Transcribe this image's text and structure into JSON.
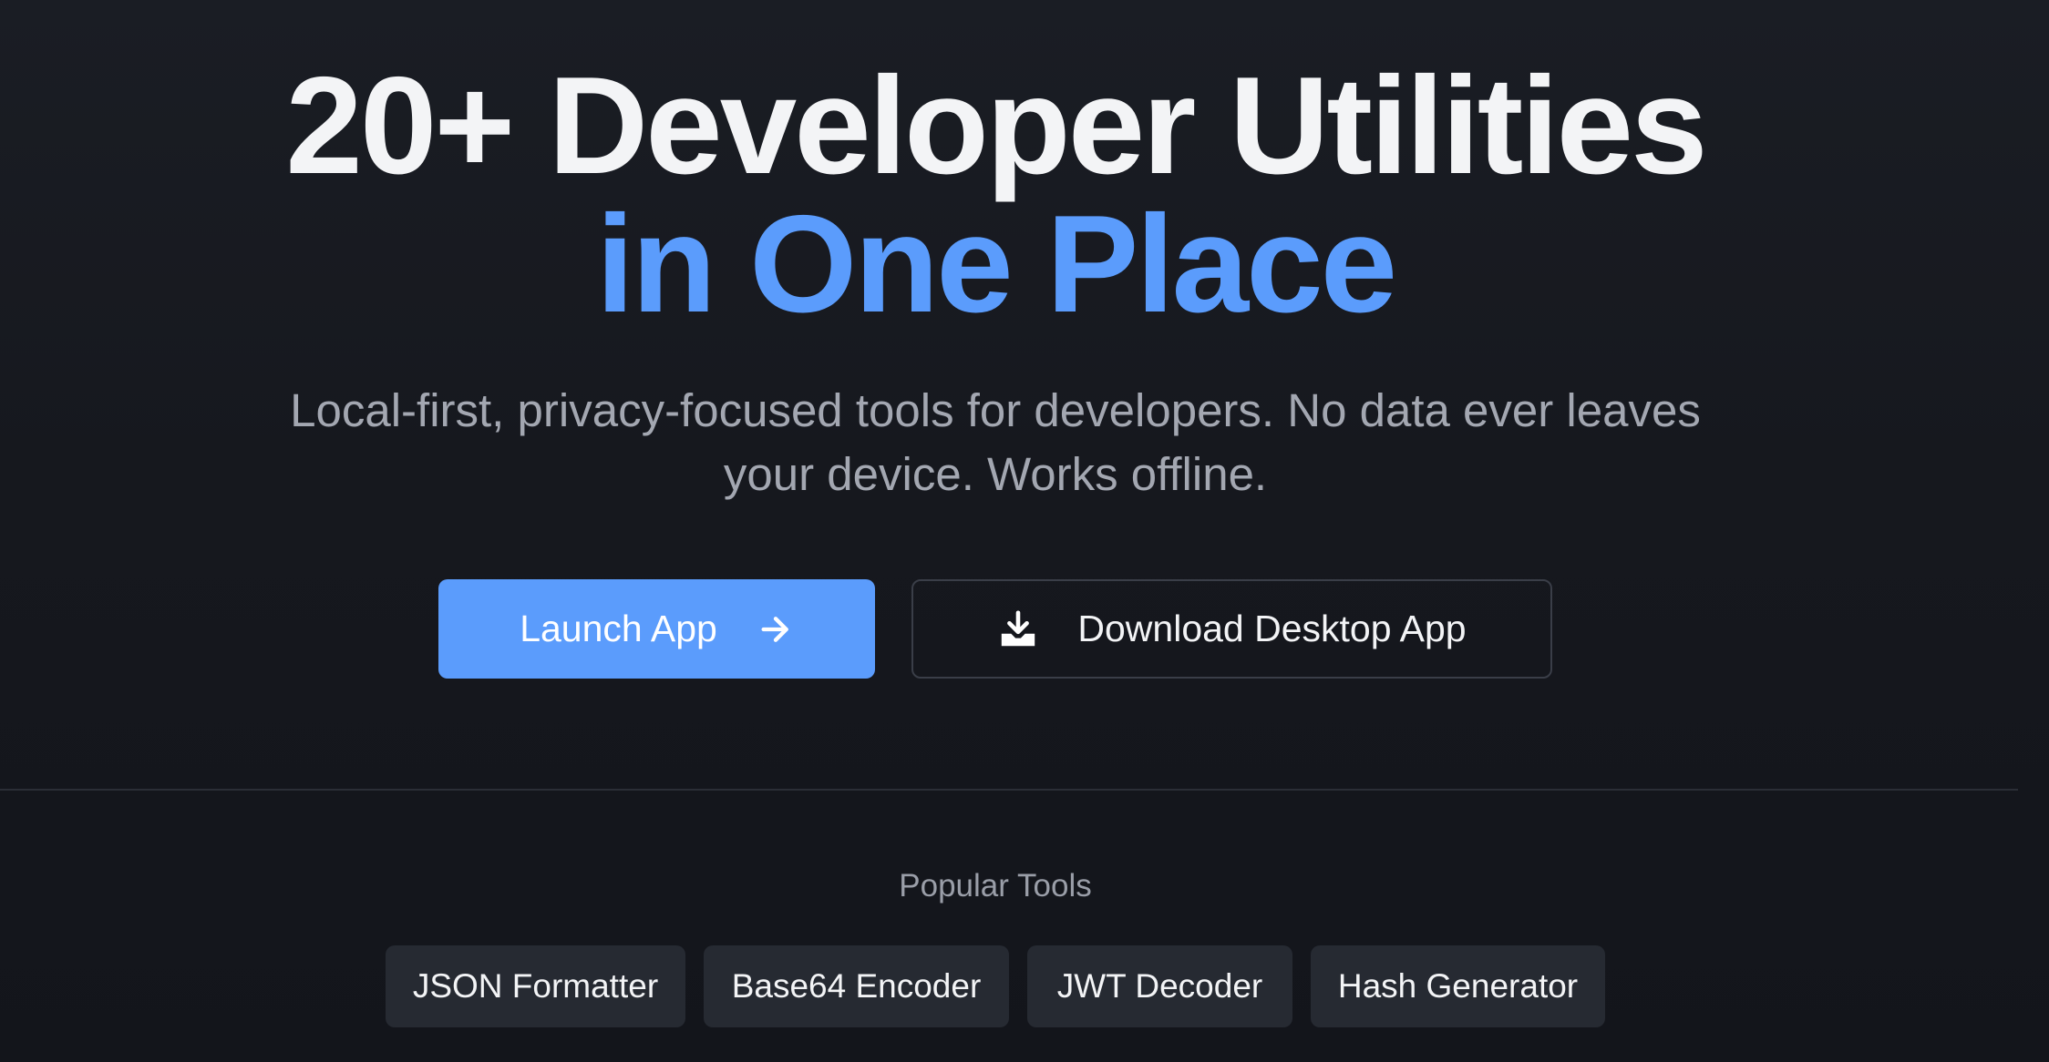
{
  "hero": {
    "headline_line1": "20+ Developer Utilities",
    "headline_line2": "in One Place",
    "subtitle_line1": "Local-first, privacy-focused tools for developers. No data ever leaves",
    "subtitle_line2": "your device. Works offline.",
    "primary_button": {
      "label": "Launch App",
      "icon": "arrow-right-icon"
    },
    "secondary_button": {
      "label": "Download Desktop App",
      "icon": "download-icon"
    }
  },
  "popular_tools": {
    "heading": "Popular Tools",
    "items": [
      {
        "label": "JSON Formatter"
      },
      {
        "label": "Base64 Encoder"
      },
      {
        "label": "JWT Decoder"
      },
      {
        "label": "Hash Generator"
      }
    ]
  },
  "colors": {
    "background": "#16181e",
    "accent": "#5b9cfc",
    "text_primary": "#f3f4f6",
    "text_muted": "#a3a7b1",
    "chip_background": "#262a32",
    "border": "#3a3e48"
  }
}
